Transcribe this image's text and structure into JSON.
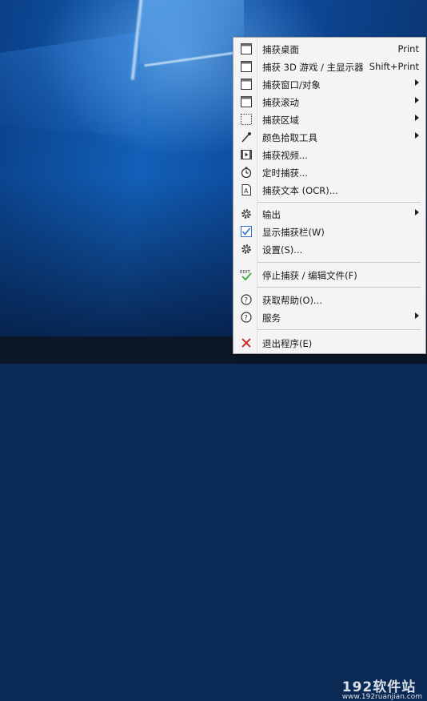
{
  "menu": {
    "items": [
      {
        "label": "捕获桌面",
        "shortcut": "Print",
        "icon": "desktop-frame-icon"
      },
      {
        "label": "捕获 3D 游戏 / 主显示器",
        "shortcut": "Shift+Print",
        "icon": "window-frame-icon"
      },
      {
        "label": "捕获窗口/对象",
        "icon": "window-object-icon"
      },
      {
        "label": "捕获滚动",
        "icon": "scroll-frame-icon"
      },
      {
        "label": "捕获区域",
        "icon": "region-dotted-icon"
      },
      {
        "label": "颜色拾取工具",
        "icon": "eyedropper-icon"
      },
      {
        "label": "捕获视频...",
        "icon": "film-icon"
      },
      {
        "label": "定时捕获...",
        "icon": "timer-icon"
      },
      {
        "label": "捕获文本 (OCR)...",
        "icon": "ocr-document-icon"
      },
      {
        "label": "输出",
        "icon": "gear-icon"
      },
      {
        "label": "显示捕获栏(W)",
        "icon": "checkbox-checked-icon"
      },
      {
        "label": "设置(S)...",
        "icon": "gear-icon"
      },
      {
        "label": "停止捕获 / 编辑文件(F)",
        "icon": "edit-check-icon",
        "icon_text": "EDIT"
      },
      {
        "label": "获取帮助(O)...",
        "icon": "help-circle-icon"
      },
      {
        "label": "服务",
        "icon": "help-circle-icon"
      },
      {
        "label": "退出程序(E)",
        "icon": "close-x-icon"
      }
    ]
  },
  "watermark": {
    "text": "192软件站",
    "sub": "www.192ruanjian.com"
  },
  "colors": {
    "accent_blue": "#2e6fd0",
    "exit_red": "#d4302b",
    "check_green": "#3aa84a"
  }
}
